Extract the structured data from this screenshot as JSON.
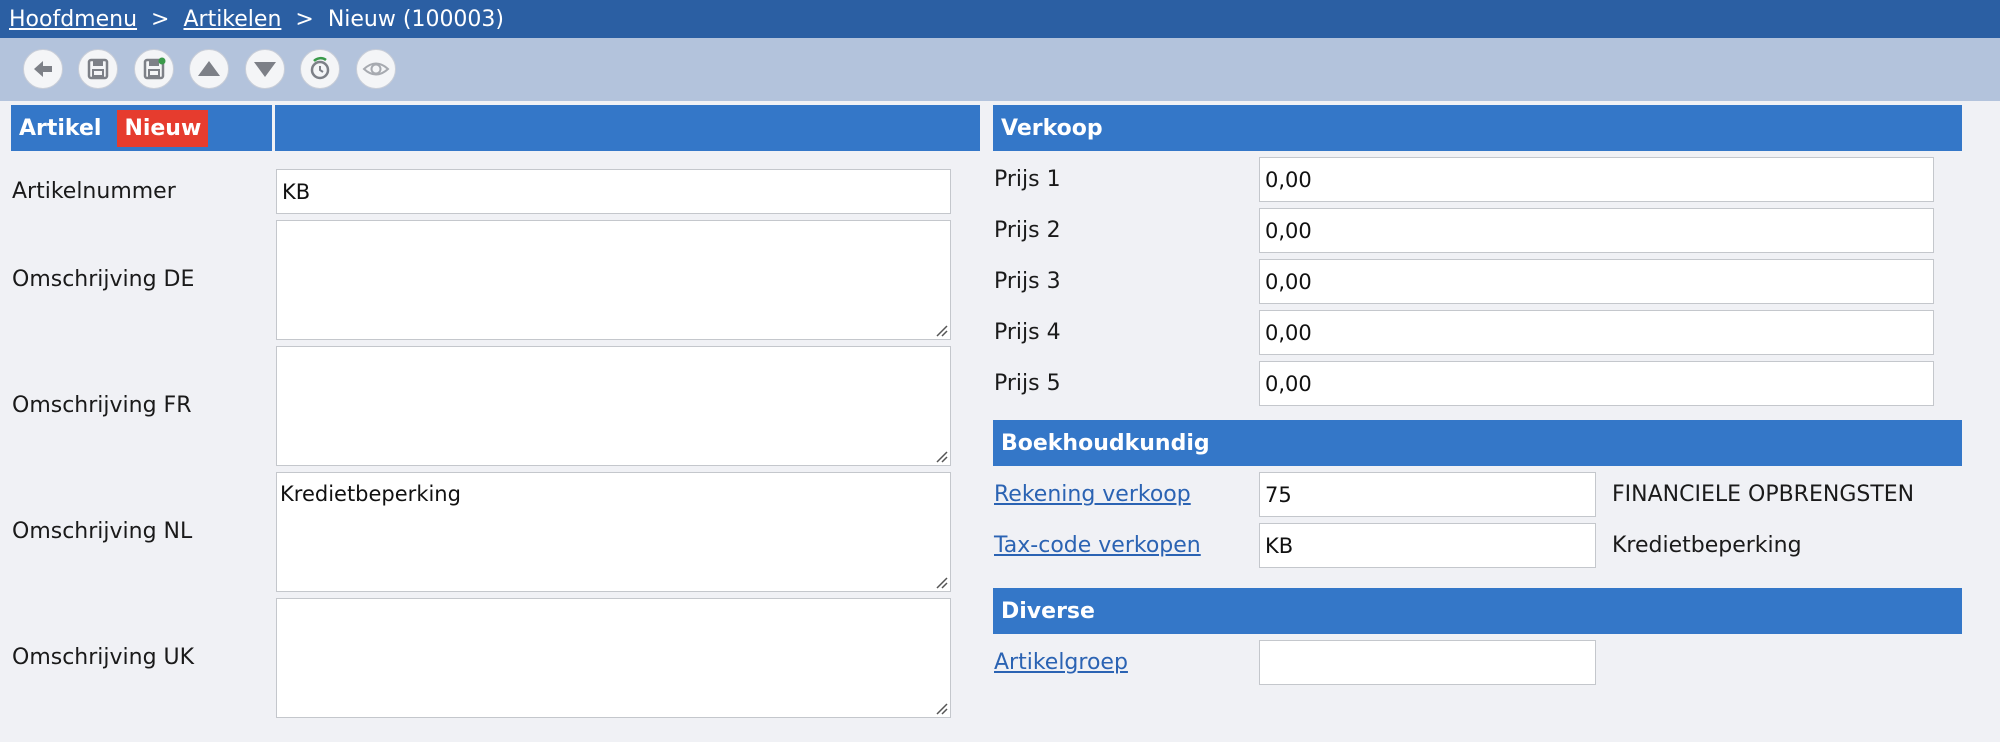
{
  "breadcrumb": {
    "home": "Hoofdmenu",
    "section": "Artikelen",
    "separator": ">",
    "current": "Nieuw (100003)"
  },
  "toolbar": {
    "buttons": [
      "back-icon",
      "save-icon",
      "save-new-icon",
      "arrow-up-icon",
      "arrow-down-icon",
      "history-icon",
      "preview-icon"
    ]
  },
  "artikel": {
    "header": "Artikel",
    "badge": "Nieuw",
    "fields": {
      "artikelnummer": {
        "label": "Artikelnummer",
        "value": "KB"
      },
      "omschrijving_de": {
        "label": "Omschrijving DE",
        "value": ""
      },
      "omschrijving_fr": {
        "label": "Omschrijving FR",
        "value": ""
      },
      "omschrijving_nl": {
        "label": "Omschrijving NL",
        "value": "Kredietbeperking"
      },
      "omschrijving_uk": {
        "label": "Omschrijving UK",
        "value": ""
      }
    }
  },
  "verkoop": {
    "header": "Verkoop",
    "prices": [
      {
        "label": "Prijs 1",
        "value": "0,00"
      },
      {
        "label": "Prijs 2",
        "value": "0,00"
      },
      {
        "label": "Prijs 3",
        "value": "0,00"
      },
      {
        "label": "Prijs 4",
        "value": "0,00"
      },
      {
        "label": "Prijs 5",
        "value": "0,00"
      }
    ]
  },
  "boekhoudkundig": {
    "header": "Boekhoudkundig",
    "rekening": {
      "label": "Rekening verkoop",
      "value": "75",
      "description": "FINANCIELE OPBRENGSTEN"
    },
    "taxcode": {
      "label": "Tax-code verkopen",
      "value": "KB",
      "description": "Kredietbeperking"
    }
  },
  "diverse": {
    "header": "Diverse",
    "artikelgroep": {
      "label": "Artikelgroep",
      "value": ""
    }
  },
  "colors": {
    "topbar": "#2b5fa3",
    "toolbar": "#b3c3dc",
    "section": "#3477c8",
    "badge": "#e63c2e",
    "link": "#2b63b3",
    "background": "#f0f1f5"
  }
}
